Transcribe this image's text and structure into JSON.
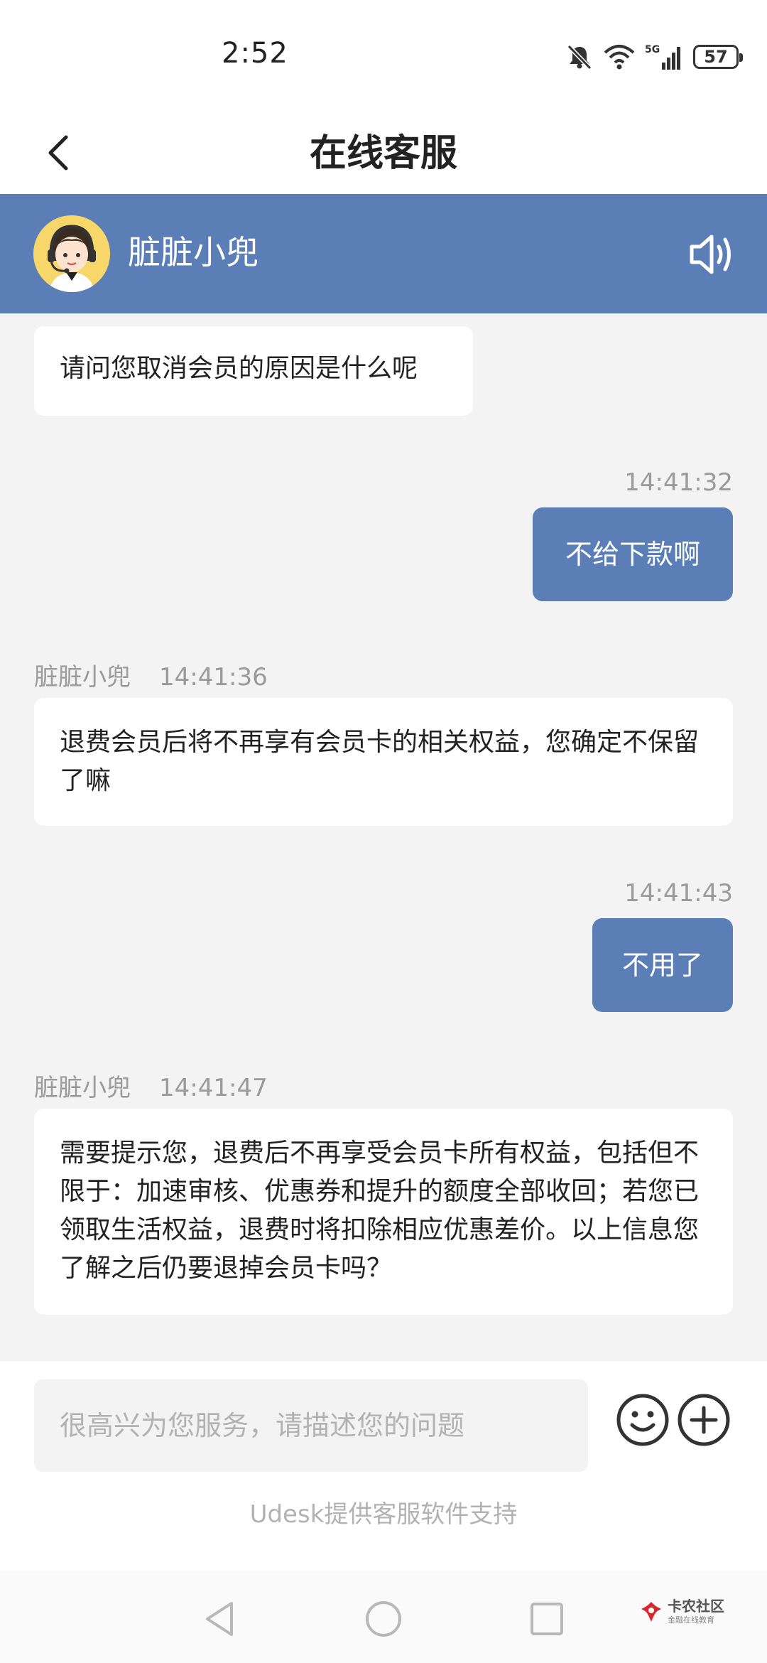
{
  "status_bar": {
    "time": "2:52",
    "battery": "57",
    "network": "5G"
  },
  "header": {
    "title": "在线客服"
  },
  "agent": {
    "name": "脏脏小兜"
  },
  "messages": [
    {
      "from": "agent",
      "text": "请问您取消会员的原因是什么呢"
    },
    {
      "from": "user",
      "time": "14:41:32",
      "text": "不给下款啊"
    },
    {
      "from": "agent",
      "sender": "脏脏小兜",
      "time": "14:41:36",
      "text": "退费会员后将不再享有会员卡的相关权益，您确定不保留了嘛"
    },
    {
      "from": "user",
      "time": "14:41:43",
      "text": "不用了"
    },
    {
      "from": "agent",
      "sender": "脏脏小兜",
      "time": "14:41:47",
      "text": "需要提示您，退费后不再享受会员卡所有权益，包括但不限于：加速审核、优惠券和提升的额度全部收回；若您已领取生活权益，退费时将扣除相应优惠差价。以上信息您了解之后仍要退掉会员卡吗？"
    }
  ],
  "input": {
    "placeholder": "很高兴为您服务，请描述您的问题",
    "value": ""
  },
  "footer": {
    "powered_by": "Udesk提供客服软件支持"
  },
  "watermark": {
    "main": "卡农社区",
    "sub": "金融在线教育"
  },
  "colors": {
    "accent": "#5b7eb7",
    "background": "#f3f3f3",
    "watermark_red": "#d9262c"
  }
}
